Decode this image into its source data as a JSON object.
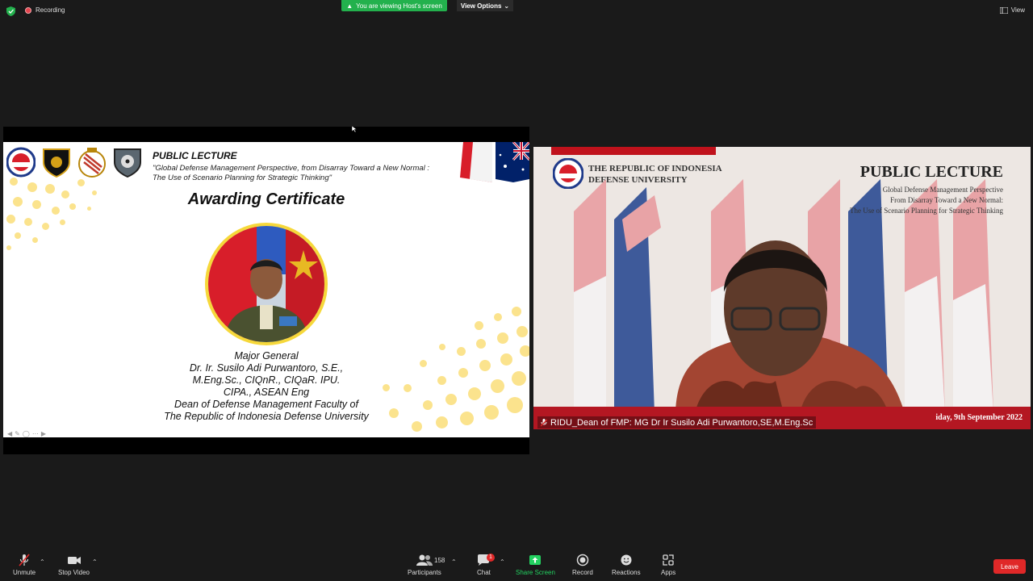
{
  "topbar": {
    "recording_label": "Recording",
    "viewing_banner": "You are viewing Host's screen",
    "view_options_label": "View Options",
    "view_label": "View"
  },
  "slide": {
    "title": "PUBLIC LECTURE",
    "subtitle_line1": "\"Global Defense Management Perspective, from Disarray Toward a New Normal :",
    "subtitle_line2": "The Use of Scenario Planning for Strategic Thinking\"",
    "heading": "Awarding Certificate",
    "bio": [
      "Major General",
      "Dr. Ir. Susilo Adi Purwantoro, S.E.,",
      "M.Eng.Sc., CIQnR., CIQaR. IPU.",
      "CIPA., ASEAN Eng",
      "Dean of Defense Management Faculty of",
      "The Republic of Indonesia Defense University"
    ]
  },
  "video": {
    "university_line1": "THE REPUBLIC OF INDONESIA",
    "university_line2": "DEFENSE UNIVERSITY",
    "lecture_title": "PUBLIC LECTURE",
    "lecture_sub1": "Global Defense Management Perspective",
    "lecture_sub2": "From Disarray Toward a New Normal:",
    "lecture_sub3": "The Use of Scenario Planning for Strategic Thinking",
    "date_text": "iday, 9th September 2022",
    "participant_name": "RIDU_Dean of FMP: MG Dr Ir Susilo Adi Purwantoro,SE,M.Eng.Sc"
  },
  "toolbar": {
    "unmute": "Unmute",
    "stop_video": "Stop Video",
    "participants": "Participants",
    "participant_count": "158",
    "chat": "Chat",
    "chat_badge": "1",
    "share_screen": "Share Screen",
    "record": "Record",
    "reactions": "Reactions",
    "apps": "Apps",
    "leave": "Leave"
  },
  "colors": {
    "share_green": "#23b14d",
    "leave_red": "#e02828",
    "dot_yellow": "#fbe38d",
    "portrait_ring": "#f6d83a"
  }
}
